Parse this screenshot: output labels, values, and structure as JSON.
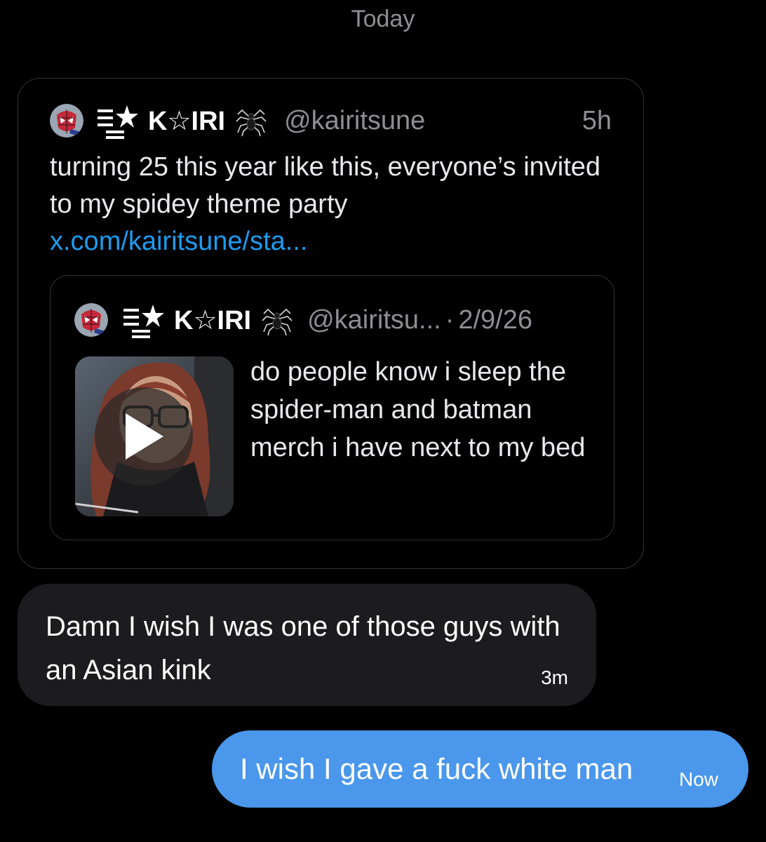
{
  "thread": {
    "date_header": "Today"
  },
  "shared_post": {
    "author": {
      "display_name": "K☆IRI",
      "handle": "@kairitsune",
      "avatar_icon": "spider-man-avatar",
      "name_prefix_icon": "list-star-icon",
      "name_suffix_icon": "spider-emoji"
    },
    "time": "5h",
    "text": "turning 25 this year like this, everyone’s invited to my spidey theme party ",
    "link": "x.com/kairitsune/sta...",
    "quoted_post": {
      "author": {
        "display_name": "K☆IRI",
        "handle": "@kairitsu...",
        "avatar_icon": "spider-man-avatar"
      },
      "separator": "·",
      "date": "2/9/26",
      "text": "do people know i sleep the spider-man and batman merch i have next to my bed",
      "media_icon": "video-thumbnail",
      "play_icon": "play-icon"
    }
  },
  "messages": [
    {
      "direction": "incoming",
      "text": "Damn I wish I was one of those guys with an Asian kink",
      "time": "3m"
    },
    {
      "direction": "outgoing",
      "text": "I wish I gave a fuck white man",
      "time": "Now"
    }
  ],
  "colors": {
    "background": "#000000",
    "incoming_bubble": "#1c1c1e",
    "outgoing_bubble": "#4a97ec",
    "link": "#1d9bf0",
    "secondary_text": "#8e8e93",
    "card_border": "#2f3336"
  }
}
